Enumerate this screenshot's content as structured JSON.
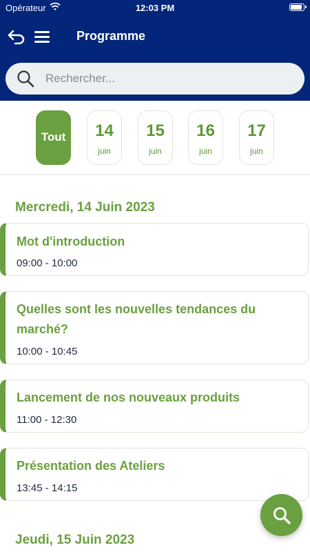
{
  "status_bar": {
    "carrier": "Opérateur",
    "time": "12:03 PM"
  },
  "header": {
    "title": "Programme"
  },
  "search": {
    "placeholder": "Rechercher..."
  },
  "date_filter": {
    "all_label": "Tout",
    "dates": [
      {
        "day": "14",
        "month": "juin"
      },
      {
        "day": "15",
        "month": "juin"
      },
      {
        "day": "16",
        "month": "juin"
      },
      {
        "day": "17",
        "month": "juin"
      }
    ]
  },
  "program": [
    {
      "day_title": "Mercredi, 14 Juin 2023",
      "sessions": [
        {
          "title": "Mot d'introduction",
          "time": "09:00 - 10:00"
        },
        {
          "title": "Quelles sont les nouvelles tendances du marché?",
          "time": "10:00 - 10:45"
        },
        {
          "title": "Lancement de nos nouveaux produits",
          "time": "11:00 - 12:30"
        },
        {
          "title": "Présentation des Ateliers",
          "time": "13:45 - 14:15"
        }
      ]
    },
    {
      "day_title": "Jeudi, 15 Juin 2023",
      "sessions": []
    }
  ],
  "colors": {
    "header": "#03257a",
    "accent": "#6aa03f"
  },
  "icons": {
    "back": "undo-arrow-icon",
    "menu": "hamburger-menu-icon",
    "search": "search-icon",
    "fab": "search-icon"
  }
}
